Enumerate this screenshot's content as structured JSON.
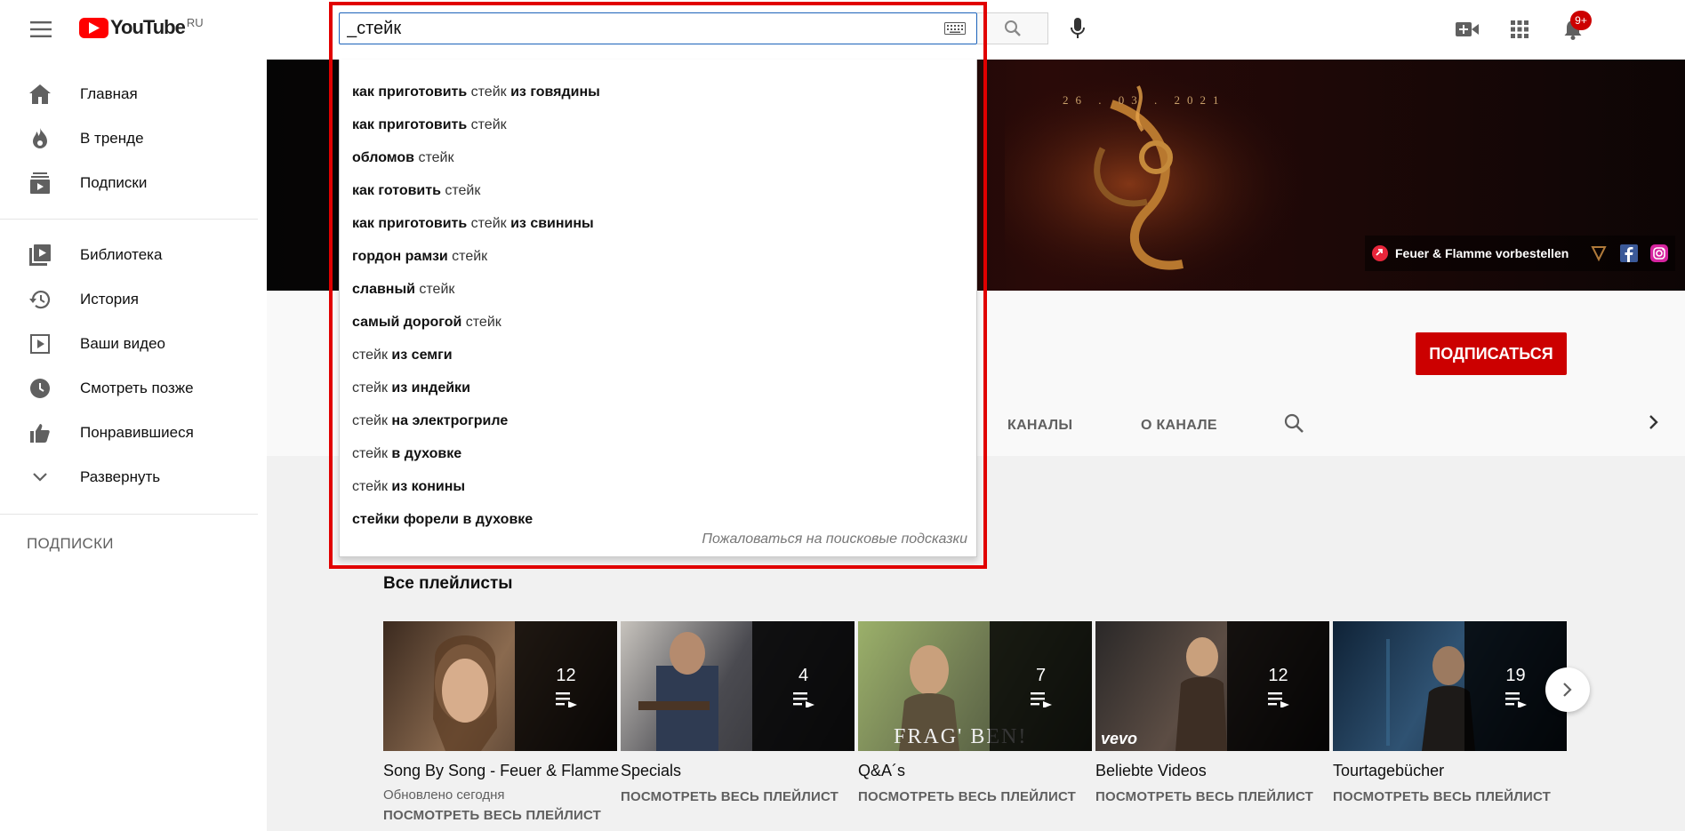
{
  "header": {
    "logo_text": "YouTube",
    "logo_region": "RU",
    "search_value": "_стейк",
    "notification_count": "9+"
  },
  "sidebar": {
    "items": [
      {
        "label": "Главная",
        "icon": "home-icon"
      },
      {
        "label": "В тренде",
        "icon": "trending-icon"
      },
      {
        "label": "Подписки",
        "icon": "subscriptions-icon"
      },
      {
        "label": "Библиотека",
        "icon": "library-icon"
      },
      {
        "label": "История",
        "icon": "history-icon"
      },
      {
        "label": "Ваши видео",
        "icon": "your-videos-icon"
      },
      {
        "label": "Смотреть позже",
        "icon": "watch-later-icon"
      },
      {
        "label": "Понравившиеся",
        "icon": "liked-icon"
      },
      {
        "label": "Развернуть",
        "icon": "chevron-down-icon"
      }
    ],
    "subscriptions_heading": "ПОДПИСКИ"
  },
  "suggestions": {
    "items": [
      [
        {
          "t": "как приготовить ",
          "b": true
        },
        {
          "t": "стейк",
          "b": false
        },
        {
          "t": " из говядины",
          "b": true
        }
      ],
      [
        {
          "t": "как приготовить ",
          "b": true
        },
        {
          "t": "стейк",
          "b": false
        }
      ],
      [
        {
          "t": "обломов ",
          "b": true
        },
        {
          "t": "стейк",
          "b": false
        }
      ],
      [
        {
          "t": "как готовить ",
          "b": true
        },
        {
          "t": "стейк",
          "b": false
        }
      ],
      [
        {
          "t": "как приготовить ",
          "b": true
        },
        {
          "t": "стейк",
          "b": false
        },
        {
          "t": " из свинины",
          "b": true
        }
      ],
      [
        {
          "t": "гордон рамзи ",
          "b": true
        },
        {
          "t": "стейк",
          "b": false
        }
      ],
      [
        {
          "t": "славный ",
          "b": true
        },
        {
          "t": "стейк",
          "b": false
        }
      ],
      [
        {
          "t": "самый дорогой ",
          "b": true
        },
        {
          "t": "стейк",
          "b": false
        }
      ],
      [
        {
          "t": "стейк",
          "b": false
        },
        {
          "t": " из семги",
          "b": true
        }
      ],
      [
        {
          "t": "стейк",
          "b": false
        },
        {
          "t": " из индейки",
          "b": true
        }
      ],
      [
        {
          "t": "стейк",
          "b": false
        },
        {
          "t": " на электрогриле",
          "b": true
        }
      ],
      [
        {
          "t": "стейк",
          "b": false
        },
        {
          "t": " в духовке",
          "b": true
        }
      ],
      [
        {
          "t": "стейк",
          "b": false
        },
        {
          "t": " из конины",
          "b": true
        }
      ],
      [
        {
          "t": "стейки форели в духовке",
          "b": true
        }
      ]
    ],
    "report_link": "Пожаловаться на поисковые подсказки"
  },
  "banner": {
    "date": "26 . 03 . 2021",
    "preorder_text": "Feuer & Flamme vorbestellen"
  },
  "channel": {
    "subscribe_label": "ПОДПИСАТЬСЯ",
    "tabs": [
      "КАНАЛЫ",
      "О КАНАЛЕ"
    ]
  },
  "playlists": {
    "section_title": "Все плейлисты",
    "items": [
      {
        "title": "Song By Song - Feuer & Flamme",
        "count": "12",
        "meta": "Обновлено сегодня",
        "link": "ПОСМОТРЕТЬ ВЕСЬ ПЛЕЙЛИСТ",
        "color": "#5a4030"
      },
      {
        "title": "Specials",
        "count": "4",
        "meta": "",
        "link": "ПОСМОТРЕТЬ ВЕСЬ ПЛЕЙЛИСТ",
        "color": "#4a4a4e"
      },
      {
        "title": "Q&A´s",
        "count": "7",
        "meta": "",
        "link": "ПОСМОТРЕТЬ ВЕСЬ ПЛЕЙЛИСТ",
        "color": "#6f7a52"
      },
      {
        "title": "Beliebte Videos",
        "count": "12",
        "meta": "",
        "link": "ПОСМОТРЕТЬ ВЕСЬ ПЛЕЙЛИСТ",
        "color": "#3a3434"
      },
      {
        "title": "Tourtagebücher",
        "count": "19",
        "meta": "",
        "link": "ПОСМОТРЕТЬ ВЕСЬ ПЛЕЙЛИСТ",
        "color": "#1e3348"
      }
    ],
    "thumb_overlays": {
      "card_3": "FRAG' BEN!",
      "card_4": "vevo"
    }
  },
  "colors": {
    "accent": "#cc0000",
    "search_border": "#1c62b9",
    "highlight_box": "#e10000"
  }
}
